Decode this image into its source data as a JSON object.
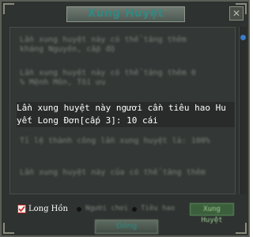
{
  "window": {
    "title": "Xung Huyệt",
    "close_glyph": "✕"
  },
  "content": {
    "blurred_lines": [
      "Lần xung huyệt này có thể tăng thêm",
      "kháng Nguyên, cấp độ",
      "Lần xung huyệt này có thể tăng thêm 0",
      "% Mệnh Môn, Tối ưu",
      "Tỉ lệ thành công lần xung huyệt là: 100%",
      "Lần xung huyệt này của có thể tăng thêm"
    ],
    "highlight_text": "Lần xung huyệt này ngươi cần tiêu hao Hu\nyết Long Đơn[cấp 3]: 10 cái"
  },
  "options": {
    "checkbox_label": "Long Hồn",
    "checkbox_checked": true,
    "radio_option_1": "Người chơi",
    "radio_option_2": "Tiêu hao",
    "action_button": "Xung Huyệt"
  },
  "footer": {
    "button_label": "Đóng"
  },
  "colors": {
    "title_text": "#2f8a82",
    "scroll_thumb": "#3a7ac8",
    "checkbox_border": "#c62424"
  }
}
